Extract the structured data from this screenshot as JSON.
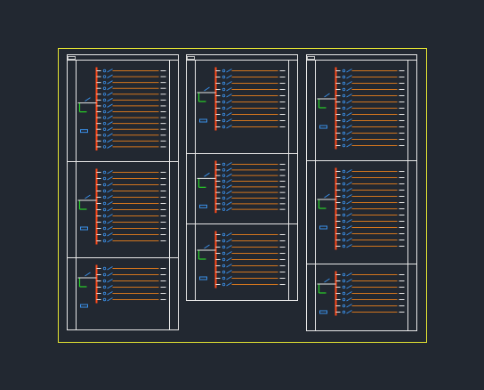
{
  "drawing": {
    "background": "#222831",
    "colors": {
      "frame": "#e6e632",
      "outline": "#e8e8e8",
      "busbar": "#ff4a1a",
      "feeder": "#d4761e",
      "breaker": "#3a8fe8",
      "incoming": "#28d228",
      "tag": "#3a8fe8"
    },
    "columns": [
      {
        "name": "column-1",
        "panels": [
          {
            "name": "panel-1-1",
            "feeders": 14
          },
          {
            "name": "panel-1-2",
            "feeders": 12
          },
          {
            "name": "panel-1-3",
            "feeders": 6
          }
        ]
      },
      {
        "name": "column-2",
        "panels": [
          {
            "name": "panel-2-1",
            "feeders": 10
          },
          {
            "name": "panel-2-2",
            "feeders": 9
          },
          {
            "name": "panel-2-3",
            "feeders": 9
          }
        ]
      },
      {
        "name": "column-3",
        "panels": [
          {
            "name": "panel-3-1",
            "feeders": 13
          },
          {
            "name": "panel-3-2",
            "feeders": 13
          },
          {
            "name": "panel-3-3",
            "feeders": 7
          }
        ]
      }
    ]
  }
}
